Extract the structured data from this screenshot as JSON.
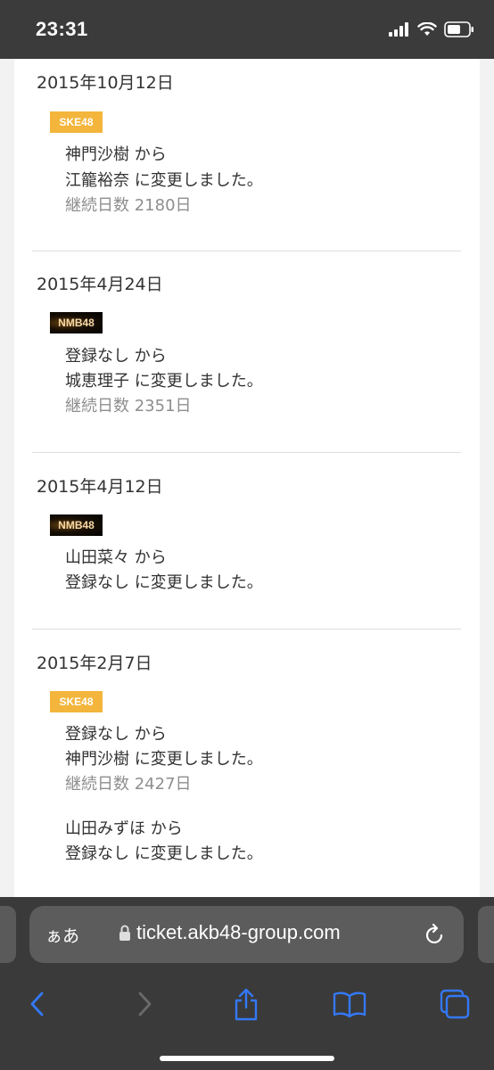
{
  "status_bar": {
    "time": "23:31"
  },
  "entries": [
    {
      "date": "2015年10月12日",
      "team": "SKE48",
      "lines": [
        {
          "text": "神門沙樹 から",
          "muted": false
        },
        {
          "text": "江籠裕奈 に変更しました。",
          "muted": false
        },
        {
          "text": "継続日数 2180日",
          "muted": true
        }
      ]
    },
    {
      "date": "2015年4月24日",
      "team": "NMB48",
      "lines": [
        {
          "text": "登録なし から",
          "muted": false
        },
        {
          "text": "城恵理子 に変更しました。",
          "muted": false
        },
        {
          "text": "継続日数 2351日",
          "muted": true
        }
      ]
    },
    {
      "date": "2015年4月12日",
      "team": "NMB48",
      "lines": [
        {
          "text": "山田菜々 から",
          "muted": false
        },
        {
          "text": "登録なし に変更しました。",
          "muted": false
        }
      ]
    },
    {
      "date": "2015年2月7日",
      "team": "SKE48",
      "lines": [
        {
          "text": "登録なし から",
          "muted": false
        },
        {
          "text": "神門沙樹 に変更しました。",
          "muted": false
        },
        {
          "text": "継続日数 2427日",
          "muted": true
        },
        {
          "text": "山田みずほ から",
          "muted": false
        },
        {
          "text": "登録なし に変更しました。",
          "muted": false
        }
      ]
    }
  ],
  "browser": {
    "aa_label": "ぁあ",
    "url": "ticket.akb48-group.com"
  },
  "icons": {
    "status": [
      "cellular-signal-icon",
      "wifi-icon",
      "battery-icon"
    ],
    "toolbar": [
      "back-icon",
      "forward-icon",
      "share-icon",
      "bookmarks-icon",
      "tabs-icon"
    ]
  },
  "colors": {
    "ske_badge": "#f3b53b",
    "nmb_badge": "#000000",
    "accent": "#3478f6"
  }
}
